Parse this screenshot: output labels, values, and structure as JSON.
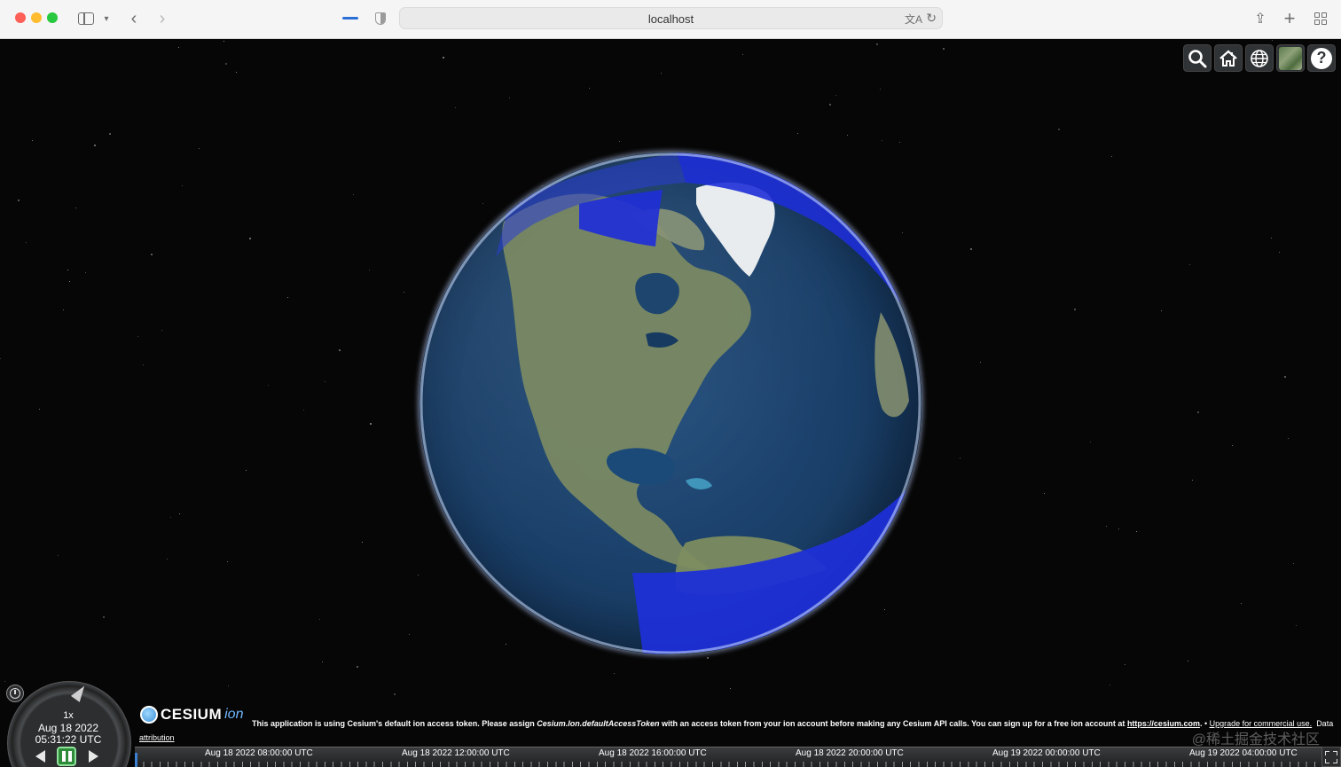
{
  "browser": {
    "url": "localhost",
    "icons": {
      "sidebar": "sidebar-icon",
      "back": "chevron-left-icon",
      "forward": "chevron-right-icon",
      "privacy": "shield-icon",
      "translate": "translate-icon",
      "reload": "reload-icon",
      "share": "share-icon",
      "new_tab": "plus-icon",
      "tab_overview": "tab-grid-icon"
    },
    "colors": {
      "close": "#fe5f57",
      "minimize": "#febc2e",
      "zoom": "#28c840",
      "loading": "#2a6fd6"
    }
  },
  "toolbar": {
    "items": [
      "search-icon",
      "home-icon",
      "globe-icon",
      "imagery-picker-icon",
      "help-icon"
    ],
    "help_label": "?"
  },
  "animation": {
    "speed": "1x",
    "date": "Aug 18 2022",
    "time": "05:31:22 UTC",
    "state": "paused"
  },
  "credits": {
    "logo_word": "CESIUM",
    "logo_suffix": "ion",
    "message_part1": "This application is using Cesium's default ion access token. Please assign ",
    "message_code": "Cesium.Ion.defaultAccessToken",
    "message_part2": " with an access token from your ion account before making any Cesium API calls. You can sign up for a free ion account at ",
    "message_link": "https://cesium.com",
    "message_part3": ".",
    "separator": " • ",
    "upgrade_link": "Upgrade for commercial use.",
    "data_label": "Data",
    "attribution": "attribution"
  },
  "timeline": {
    "ticks": [
      "Aug 18 2022 08:00:00 UTC",
      "Aug 18 2022 12:00:00 UTC",
      "Aug 18 2022 16:00:00 UTC",
      "Aug 18 2022 20:00:00 UTC",
      "Aug 19 2022 00:00:00 UTC",
      "Aug 19 2022 04:00:00 UTC"
    ]
  },
  "watermark": "@稀土掘金技术社区",
  "colors": {
    "overlay_blue": "#1e2fd6",
    "ocean": "#1a3f68",
    "land": "#7d8b63",
    "ice": "#e8ecef",
    "toolbar_bg": "#303336"
  }
}
